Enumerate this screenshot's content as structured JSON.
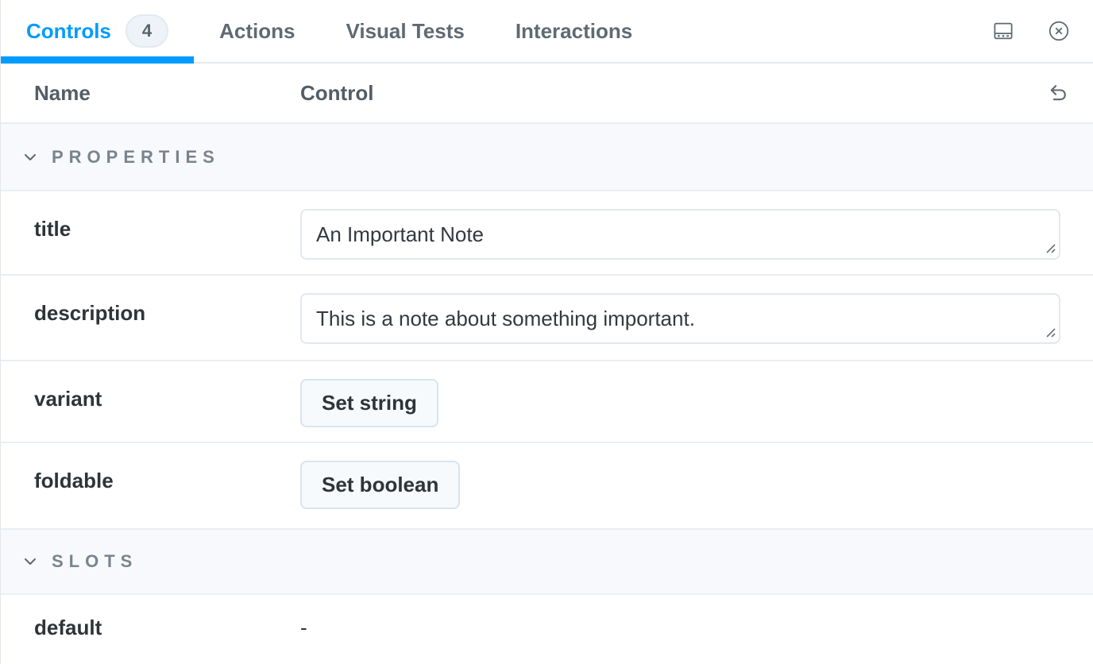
{
  "panel": {
    "tabs": [
      {
        "label": "Controls",
        "badge": "4",
        "active": true
      },
      {
        "label": "Actions",
        "active": false
      },
      {
        "label": "Visual Tests",
        "active": false
      },
      {
        "label": "Interactions",
        "active": false
      }
    ],
    "toolbar_icons": [
      "bottom-panel-icon",
      "close-icon"
    ]
  },
  "table": {
    "columns": {
      "name": "Name",
      "control": "Control"
    },
    "reset_icon": "undo-icon"
  },
  "sections": [
    {
      "title": "PROPERTIES",
      "rows": [
        {
          "name": "title",
          "control_type": "textarea",
          "value": "An Important Note"
        },
        {
          "name": "description",
          "control_type": "textarea",
          "value": "This is a note about something important."
        },
        {
          "name": "variant",
          "control_type": "button",
          "button_label": "Set string"
        },
        {
          "name": "foldable",
          "control_type": "button",
          "button_label": "Set boolean"
        }
      ]
    },
    {
      "title": "SLOTS",
      "rows": [
        {
          "name": "default",
          "control_type": "text",
          "value": "-"
        }
      ]
    }
  ],
  "colors": {
    "accent": "#029CFD",
    "text": "#2E3438",
    "muted_text": "#5C6870",
    "section_bg": "#F7F9FC",
    "border": "#EAEEF2",
    "button_border": "#D7E5F0",
    "button_bg": "#F7FAFD"
  }
}
